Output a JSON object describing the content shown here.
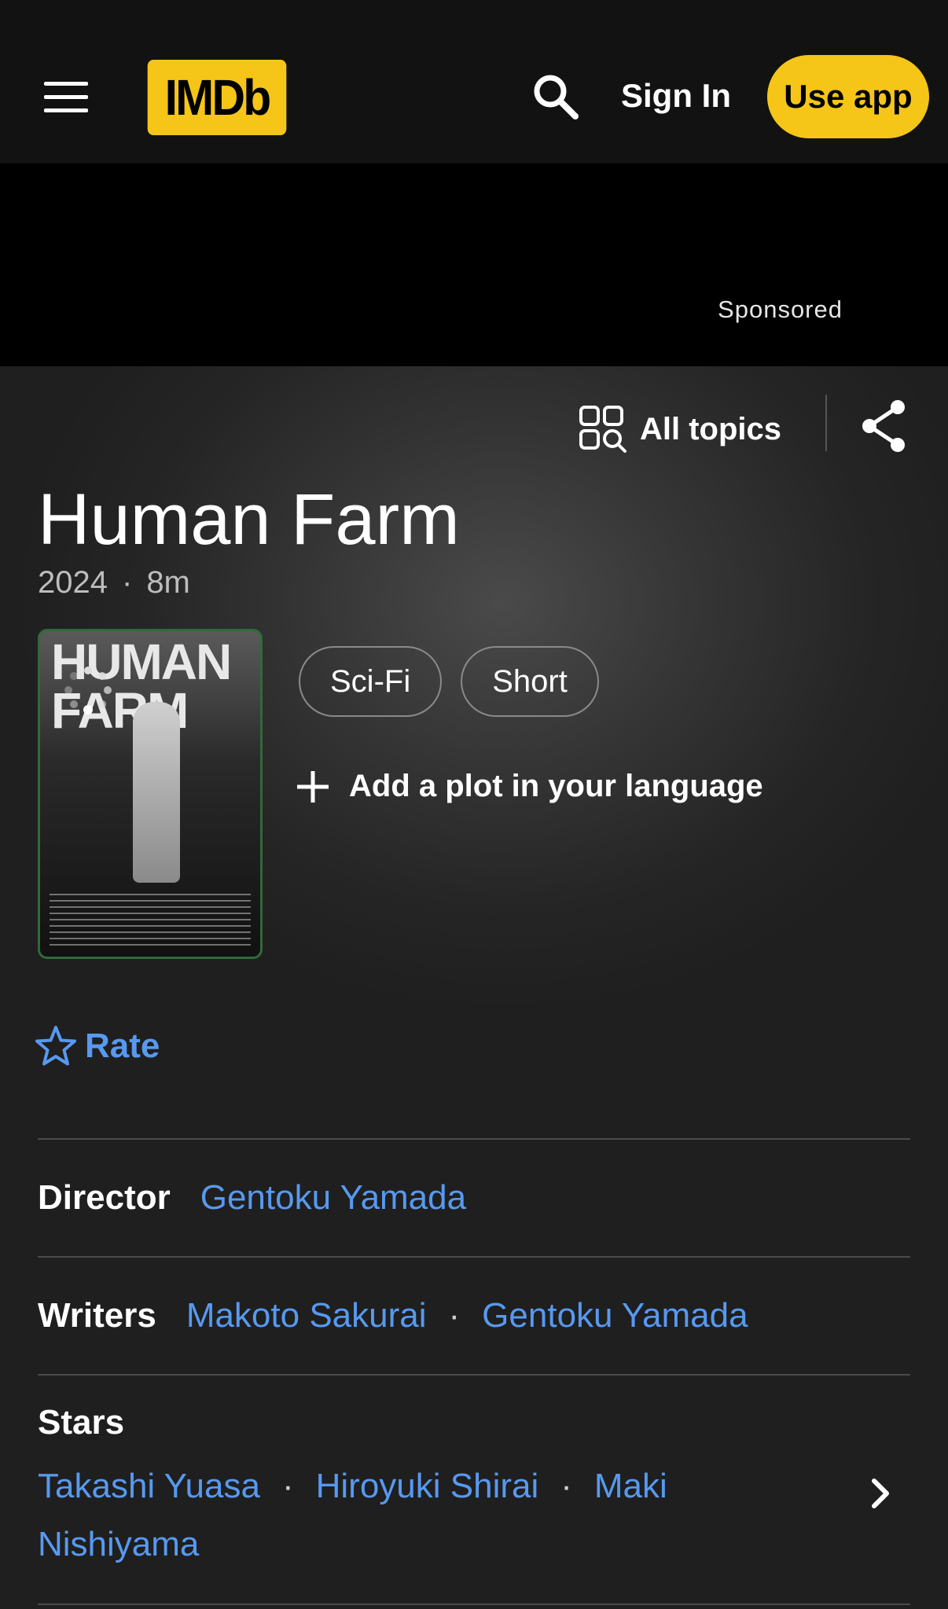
{
  "header": {
    "logo_text": "IMDb",
    "sign_in": "Sign In",
    "use_app": "Use app"
  },
  "ad": {
    "sponsored_label": "Sponsored"
  },
  "toolbar": {
    "all_topics": "All topics"
  },
  "title": {
    "name": "Human Farm",
    "year": "2024",
    "dot": "·",
    "runtime": "8m"
  },
  "poster": {
    "text": "HUMAN FARM"
  },
  "genres": [
    "Sci-Fi",
    "Short"
  ],
  "add_plot": "Add a plot in your language",
  "rate_label": "Rate",
  "credits": {
    "director_label": "Director",
    "director": "Gentoku Yamada",
    "writers_label": "Writers",
    "writers": [
      "Makoto Sakurai",
      "Gentoku Yamada"
    ],
    "stars_label": "Stars",
    "stars": [
      "Takashi Yuasa",
      "Hiroyuki Shirai",
      "Maki Nishiyama"
    ],
    "separator": "·"
  },
  "colors": {
    "brand_yellow": "#f5c518",
    "link_blue": "#5799ef",
    "header_bg": "#121212"
  }
}
